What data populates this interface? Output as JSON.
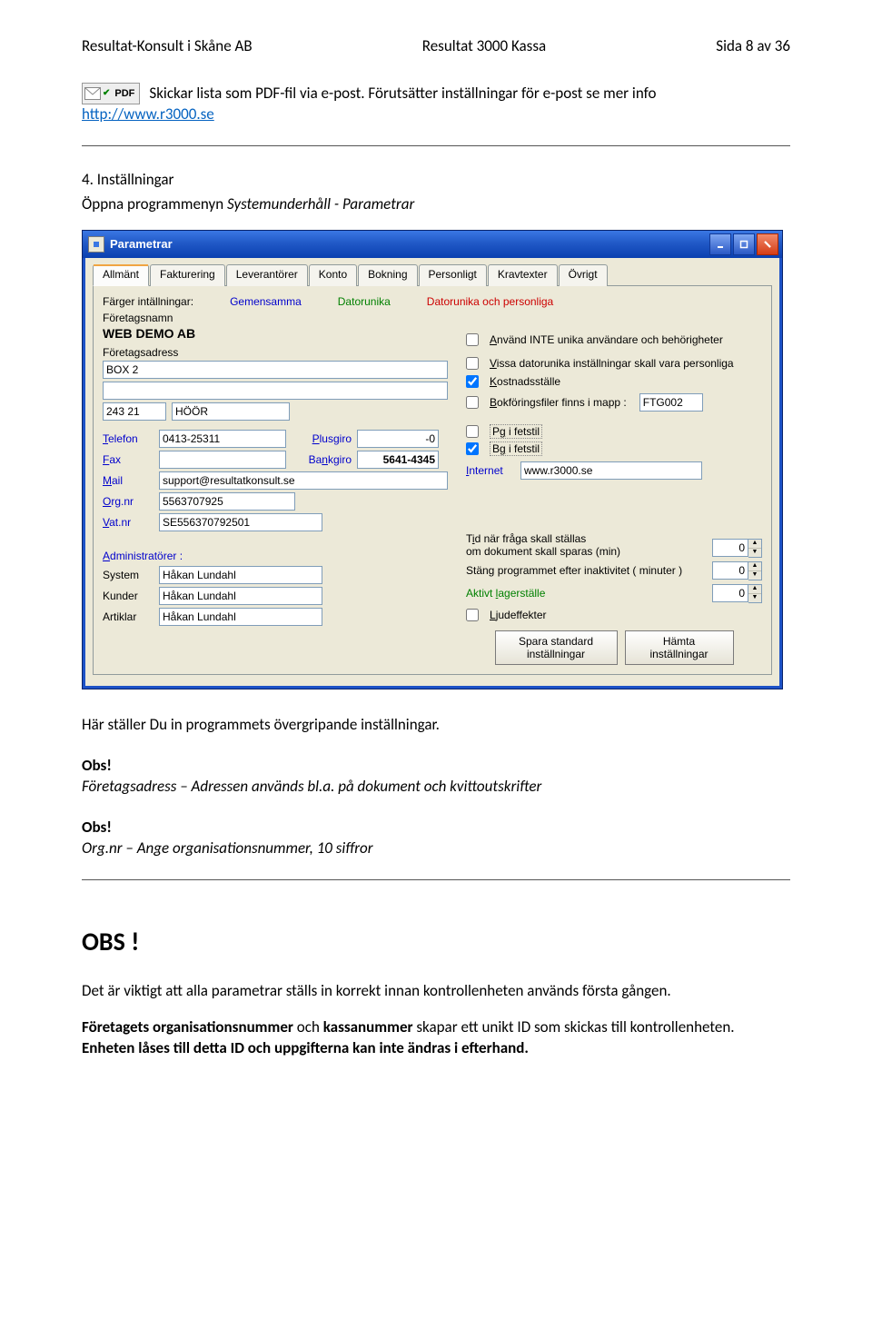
{
  "doc_header": {
    "left": "Resultat-Konsult i Skåne AB",
    "center": "Resultat 3000 Kassa",
    "right": "Sida 8 av 36"
  },
  "pdf_section": {
    "badge_text": "PDF",
    "desc": "Skickar lista som PDF-fil via e-post. Förutsätter inställningar för e-post se mer info",
    "link": "http://www.r3000.se"
  },
  "section4": {
    "number": "4.",
    "title": "Inställningar",
    "p1": "Öppna programmenyn Systemunderhåll - Parametrar"
  },
  "window": {
    "title": "Parametrar",
    "tabs": [
      "Allmänt",
      "Fakturering",
      "Leverantörer",
      "Konto",
      "Bokning",
      "Personligt",
      "Kravtexter",
      "Övrigt"
    ],
    "colorsettings_label": "Färger intällningar:",
    "colorsettings": {
      "a": "Gemensamma",
      "b": "Datorunika",
      "c": "Datorunika och personliga"
    },
    "lbl_foretagsnamn": "Företagsnamn",
    "foretagsnamn": "WEB DEMO AB",
    "chk1": "Använd INTE unika användare och behörigheter",
    "lbl_foretagsadress": "Företagsadress",
    "adress1": "BOX 2",
    "adress2": "",
    "chk2": "Vissa datorunika inställningar skall vara personliga",
    "chk3": "Kostnadsställe",
    "postnr": "243 21",
    "ort": "HÖÖR",
    "chk4": "Bokföringsfiler finns i mapp :",
    "bokf_mapp": "FTG002",
    "lbl_telefon": "Telefon",
    "telefon": "0413-25311",
    "lbl_plusgiro": "Plusgiro",
    "plusgiro": "-0",
    "chk_pg": "Pg i fetstil",
    "lbl_fax": "Fax",
    "fax": "",
    "lbl_bankgiro": "Bankgiro",
    "bankgiro": "5641-4345",
    "chk_bg": "Bg i fetstil",
    "lbl_mail": "Mail",
    "mail": "support@resultatkonsult.se",
    "lbl_internet": "Internet",
    "internet": "www.r3000.se",
    "lbl_orgnr": "Org.nr",
    "orgnr": "5563707925",
    "lbl_vatnr": "Vat.nr",
    "vatnr": "SE556370792501",
    "lbl_admin": "Administratörer :",
    "lbl_system": "System",
    "system": "Håkan Lundahl",
    "lbl_kunder": "Kunder",
    "kunder": "Håkan Lundahl",
    "lbl_artiklar": "Artiklar",
    "artiklar": "Håkan Lundahl",
    "spin1_line1": "Tid när fråga skall ställas",
    "spin1_line2": "om dokument skall sparas (min)",
    "spin1_val": "0",
    "spin2_label": "Stäng programmet efter inaktivitet ( minuter )",
    "spin2_val": "0",
    "spin3_label": "Aktivt lagerställe",
    "spin3_val": "0",
    "chk_ljud": "Ljudeffekter",
    "btn_save": "Spara standard\ninställningar",
    "btn_load": "Hämta\ninställningar"
  },
  "after_window": {
    "intro": "Här ställer Du in programmets övergripande inställningar.",
    "obs1_h": "Obs!",
    "obs1_t": "Företagsadress – Adressen används bl.a. på dokument och kvittoutskrifter",
    "obs2_h": "Obs!",
    "obs2_t": "Org.nr – Ange organisationsnummer, 10 siffror",
    "big_obs": "OBS !",
    "p_bottom1": "Det är viktigt att alla parametrar ställs in korrekt innan kontrollenheten används första gången.",
    "p_bottom2a": "Företagets organisationsnummer",
    "p_bottom2b": " och ",
    "p_bottom2c": "kassanummer",
    "p_bottom2d": " skapar ett unikt ID  som skickas till kontrollenheten. ",
    "p_bottom2e": "Enheten låses till detta ID och uppgifterna kan inte ändras i efterhand."
  }
}
